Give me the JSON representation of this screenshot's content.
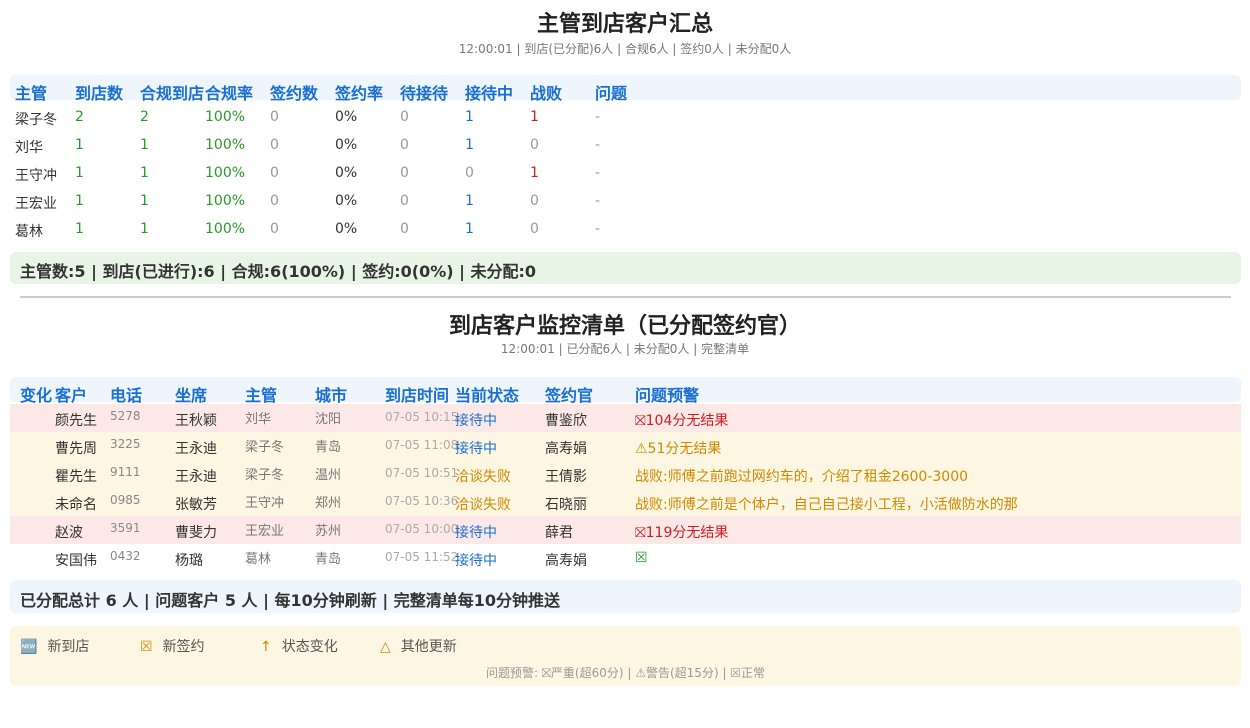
{
  "summary": {
    "title": "主管到店客户汇总",
    "subtitle": "12:00:01 | 到店(已分配)6人 | 合规6人 | 签约0人 | 未分配0人",
    "headers": [
      "主管",
      "到店数",
      "合规到店",
      "合规率",
      "签约数",
      "签约率",
      "待接待",
      "接待中",
      "战败",
      "问题"
    ],
    "rows": [
      {
        "name": "梁子冬",
        "arrive": "2",
        "compliant": "2",
        "rate": "100%",
        "signed": "0",
        "sign_rate": "0%",
        "waiting": "0",
        "serving": "1",
        "lost": "1",
        "issue": "-"
      },
      {
        "name": "刘华",
        "arrive": "1",
        "compliant": "1",
        "rate": "100%",
        "signed": "0",
        "sign_rate": "0%",
        "waiting": "0",
        "serving": "1",
        "lost": "0",
        "issue": "-"
      },
      {
        "name": "王守冲",
        "arrive": "1",
        "compliant": "1",
        "rate": "100%",
        "signed": "0",
        "sign_rate": "0%",
        "waiting": "0",
        "serving": "0",
        "lost": "1",
        "issue": "-"
      },
      {
        "name": "王宏业",
        "arrive": "1",
        "compliant": "1",
        "rate": "100%",
        "signed": "0",
        "sign_rate": "0%",
        "waiting": "0",
        "serving": "1",
        "lost": "0",
        "issue": "-"
      },
      {
        "name": "葛林",
        "arrive": "1",
        "compliant": "1",
        "rate": "100%",
        "signed": "0",
        "sign_rate": "0%",
        "waiting": "0",
        "serving": "1",
        "lost": "0",
        "issue": "-"
      }
    ],
    "totals": "主管数:5 | 到店(已进行):6 | 合规:6(100%) | 签约:0(0%) | 未分配:0"
  },
  "monitor": {
    "title": "到店客户监控清单（已分配签约官）",
    "subtitle": "12:00:01 | 已分配6人 | 未分配0人 | 完整清单",
    "headers": [
      "变化",
      "客户",
      "电话",
      "坐席",
      "主管",
      "城市",
      "到店时间",
      "当前状态",
      "签约官",
      "问题预警"
    ],
    "rows": [
      {
        "customer": "颜先生",
        "phone": "5278",
        "seat": "王秋颖",
        "supervisor": "刘华",
        "city": "沈阳",
        "time": "07-05 10:15",
        "status": "接待中",
        "officer": "曹鉴欣",
        "warning": "⛝104分无结果",
        "bg": "#fde8e8",
        "status_color": "#1a6fd1",
        "warn_color": "#cc1f1f"
      },
      {
        "customer": "曹先周",
        "phone": "3225",
        "seat": "王永迪",
        "supervisor": "梁子冬",
        "city": "青岛",
        "time": "07-05 11:08",
        "status": "接待中",
        "officer": "高寿娟",
        "warning": "⚠51分无结果",
        "bg": "#fdf6e3",
        "status_color": "#1a6fd1",
        "warn_color": "#d08a00"
      },
      {
        "customer": "瞿先生",
        "phone": "9111",
        "seat": "王永迪",
        "supervisor": "梁子冬",
        "city": "温州",
        "time": "07-05 10:51",
        "status": "洽谈失败",
        "officer": "王倩影",
        "warning": "战败:师傅之前跑过网约车的，介绍了租金2600-3000",
        "bg": "#fdf6e3",
        "status_color": "#d08a00",
        "warn_color": "#d08a00"
      },
      {
        "customer": "未命名",
        "phone": "0985",
        "seat": "张敏芳",
        "supervisor": "王守冲",
        "city": "郑州",
        "time": "07-05 10:36",
        "status": "洽谈失败",
        "officer": "石晓丽",
        "warning": "战败:师傅之前是个体户，自己自己接小工程，小活做防水的那",
        "bg": "#fdf6e3",
        "status_color": "#d08a00",
        "warn_color": "#d08a00"
      },
      {
        "customer": "赵波",
        "phone": "3591",
        "seat": "曹斐力",
        "supervisor": "王宏业",
        "city": "苏州",
        "time": "07-05 10:00",
        "status": "接待中",
        "officer": "薛君",
        "warning": "⛝119分无结果",
        "bg": "#fde8e8",
        "status_color": "#1a6fd1",
        "warn_color": "#cc1f1f"
      },
      {
        "customer": "安国伟",
        "phone": "0432",
        "seat": "杨璐",
        "supervisor": "葛林",
        "city": "青岛",
        "time": "07-05 11:52",
        "status": "接待中",
        "officer": "高寿娟",
        "warning": "☒",
        "bg": "#ffffff",
        "status_color": "#1a6fd1",
        "warn_color": "#2a9a2a"
      }
    ],
    "totals": "已分配总计 6 人 | 问题客户 5 人 | 每10分钟刷新 | 完整清单每10分钟推送"
  },
  "legend": {
    "items": [
      {
        "icon": "🆕",
        "label": "新到店",
        "icon_name": "new-icon"
      },
      {
        "icon": "☒",
        "label": "新签约",
        "icon_name": "signed-icon"
      },
      {
        "icon": "↑",
        "label": "状态变化",
        "icon_name": "arrow-up-icon"
      },
      {
        "icon": "△",
        "label": "其他更新",
        "icon_name": "triangle-icon"
      }
    ],
    "footer": "问题预警: ⛝严重(超60分) | ⚠警告(超15分) | ☒正常"
  }
}
